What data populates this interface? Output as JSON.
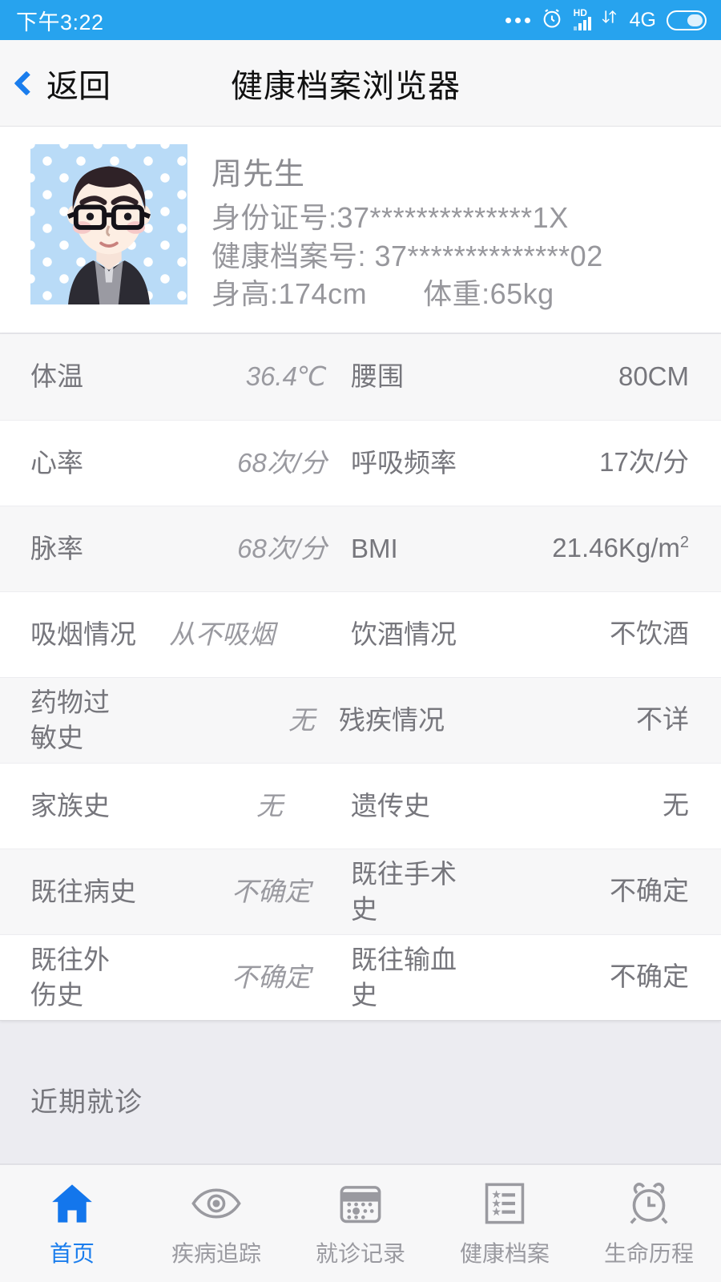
{
  "status_bar": {
    "time": "下午3:22",
    "more_icon": "more-dots-icon",
    "alarm_icon": "alarm-clock-icon",
    "hd_label": "HD",
    "signal_icon": "signal-bars-icon",
    "data_transfer_icon": "data-transfer-icon",
    "network": "4G",
    "battery_icon": "battery-icon",
    "background": "#27a3ee"
  },
  "header": {
    "back_label": "返回",
    "back_icon": "chevron-left-icon",
    "title": "健康档案浏览器",
    "accent": "#1a7ded"
  },
  "profile": {
    "avatar_icon": "user-avatar-cartoon",
    "name": "周先生",
    "id_line": "身份证号:37**************1X",
    "record_line": "健康档案号: 37**************02",
    "height": "身高:174cm",
    "weight": "体重:65kg"
  },
  "vitals": {
    "rows": [
      {
        "label1": "体温",
        "value1": "36.4℃",
        "label2": "腰围",
        "value2": "80CM"
      },
      {
        "label1": "心率",
        "value1": "68次/分",
        "label2": "呼吸频率",
        "value2": "17次/分"
      },
      {
        "label1": "脉率",
        "value1": "68次/分",
        "label2": "BMI",
        "value2": "21.46Kg/m2"
      },
      {
        "label1": "吸烟情况",
        "value1": "从不吸烟",
        "label2": "饮酒情况",
        "value2": "不饮酒"
      },
      {
        "label1": "药物过敏史",
        "value1": "无",
        "label2": "残疾情况",
        "value2": "不详"
      },
      {
        "label1": "家族史",
        "value1": "无",
        "label2": "遗传史",
        "value2": "无"
      },
      {
        "label1": "既往病史",
        "value1": "不确定",
        "label2": "既往手术史",
        "value2": "不确定"
      },
      {
        "label1": "既往外伤史",
        "value1": "不确定",
        "label2": "既往输血史",
        "value2": "不确定"
      }
    ],
    "bmi_value_main": "21.46Kg/",
    "bmi_value_unit": "m",
    "bmi_value_sup": "2"
  },
  "recent_visits": {
    "title": "近期就诊"
  },
  "tabbar": {
    "items": [
      {
        "label": "首页",
        "icon": "home-icon",
        "active": true
      },
      {
        "label": "疾病追踪",
        "icon": "eye-icon",
        "active": false
      },
      {
        "label": "就诊记录",
        "icon": "calendar-icon",
        "active": false
      },
      {
        "label": "健康档案",
        "icon": "list-star-icon",
        "active": false
      },
      {
        "label": "生命历程",
        "icon": "alarm-icon",
        "active": false
      }
    ],
    "active_color": "#1a7ded",
    "inactive_color": "#9a9aa0"
  }
}
